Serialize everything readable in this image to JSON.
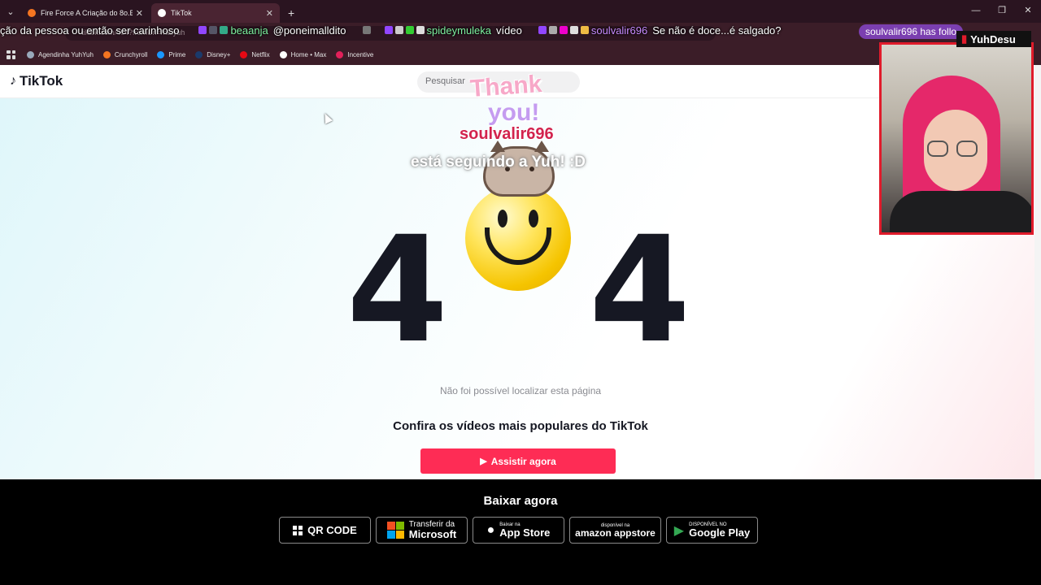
{
  "browser": {
    "tabs": [
      {
        "title": "Fire Force A Criação do 8o.Batal",
        "active": false,
        "icon": "crunchyroll-favicon"
      },
      {
        "title": "TikTok",
        "active": true,
        "icon": "tiktok-favicon"
      }
    ],
    "new_tab": "+",
    "window_controls": {
      "minimize": "—",
      "restore": "❐",
      "close": "✕"
    },
    "url": "tiktok.com/404?fromUrl=/ha.yuh",
    "bookmarks": [
      {
        "label": "Agendinha YuhYuh",
        "color": "#9ab"
      },
      {
        "label": "Crunchyroll",
        "color": "#f47521"
      },
      {
        "label": "Prime",
        "color": "#1a98ff"
      },
      {
        "label": "Disney+",
        "color": "#1b3a6b"
      },
      {
        "label": "Netflix",
        "color": "#e50914"
      },
      {
        "label": "Home • Max",
        "color": "#ffffff"
      },
      {
        "label": "Incentive",
        "color": "#e2205a"
      }
    ]
  },
  "chat": {
    "line1": "ção da pessoa ou então ser carinhoso",
    "user1": "beaanja",
    "msg1": "@poneimalldito",
    "user2": "spideymuleka",
    "msg2": "vídeo",
    "user3": "soulvalir696",
    "msg3": "Se não é doce...é salgado?",
    "follow_pill": "soulvalir696 has follo",
    "follow_pill_tail": "ll"
  },
  "tiktok": {
    "logo": "TikTok",
    "search_placeholder": "Pesquisar",
    "error_left": "4",
    "error_right": "4",
    "not_found": "Não foi possível localizar esta página",
    "popular_heading": "Confira os vídeos mais populares do TikTok",
    "watch_button": "Assistir agora"
  },
  "alert": {
    "thanks": "Thank",
    "you": "you!",
    "username": "soulvalir696",
    "message": "está seguindo a Yuh! :D"
  },
  "stream": {
    "channel_logo": "YuhDesu"
  },
  "footer": {
    "title": "Baixar agora",
    "stores": [
      {
        "small": "",
        "big": "QR CODE",
        "icon": "qr-code-icon"
      },
      {
        "small": "",
        "big": "Transferir da Microsoft",
        "line1": "Transferir da",
        "line2": "Microsoft",
        "icon": "microsoft-icon"
      },
      {
        "small": "Baixar na",
        "big": "App Store",
        "icon": "apple-icon"
      },
      {
        "small": "disponível na",
        "big": "amazon appstore",
        "icon": "amazon-icon"
      },
      {
        "small": "DISPONÍVEL NO",
        "big": "Google Play",
        "icon": "google-play-icon"
      }
    ]
  },
  "colors": {
    "tiktok_red": "#fe2c55",
    "tiktok_dark": "#161823",
    "webcam_border": "#e01b2b",
    "chat_username_green": "#7ef0a0",
    "chat_username_purple": "#c88bff"
  }
}
